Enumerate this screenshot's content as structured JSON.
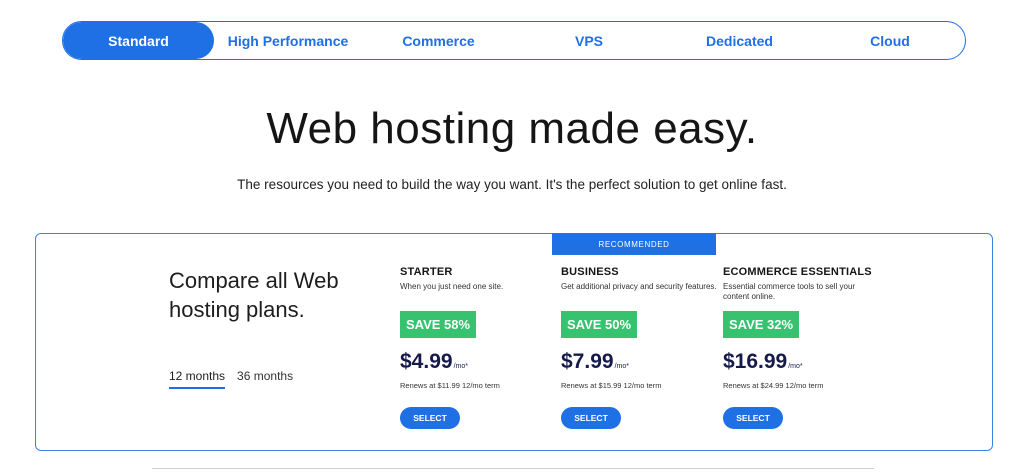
{
  "tabs": [
    {
      "label": "Standard",
      "active": true
    },
    {
      "label": "High Performance",
      "active": false
    },
    {
      "label": "Commerce",
      "active": false
    },
    {
      "label": "VPS",
      "active": false
    },
    {
      "label": "Dedicated",
      "active": false
    },
    {
      "label": "Cloud",
      "active": false
    }
  ],
  "hero": {
    "title": "Web hosting made easy.",
    "subtitle": "The resources you need to build the way you want. It's the perfect solution to get online fast."
  },
  "compare": {
    "title": "Compare all Web hosting plans.",
    "terms": [
      {
        "label": "12 months",
        "active": true
      },
      {
        "label": "36 months",
        "active": false
      }
    ]
  },
  "recommended_label": "RECOMMENDED",
  "plans": [
    {
      "name": "STARTER",
      "description": "When you just need one site.",
      "save": "SAVE 58%",
      "price": "$4.99",
      "unit": "/mo*",
      "renews": "Renews at $11.99 12/mo term",
      "select": "SELECT"
    },
    {
      "name": "BUSINESS",
      "description": "Get additional privacy and security features.",
      "save": "SAVE 50%",
      "price": "$7.99",
      "unit": "/mo*",
      "renews": "Renews at $15.99 12/mo term",
      "select": "SELECT"
    },
    {
      "name": "ECOMMERCE ESSENTIALS",
      "description": "Essential commerce tools to sell your content online.",
      "save": "SAVE 32%",
      "price": "$16.99",
      "unit": "/mo*",
      "renews": "Renews at $24.99 12/mo term",
      "select": "SELECT"
    }
  ],
  "colors": {
    "accent": "#1f6fe5",
    "save_badge": "#36c26f",
    "price_text": "#151a4a"
  }
}
